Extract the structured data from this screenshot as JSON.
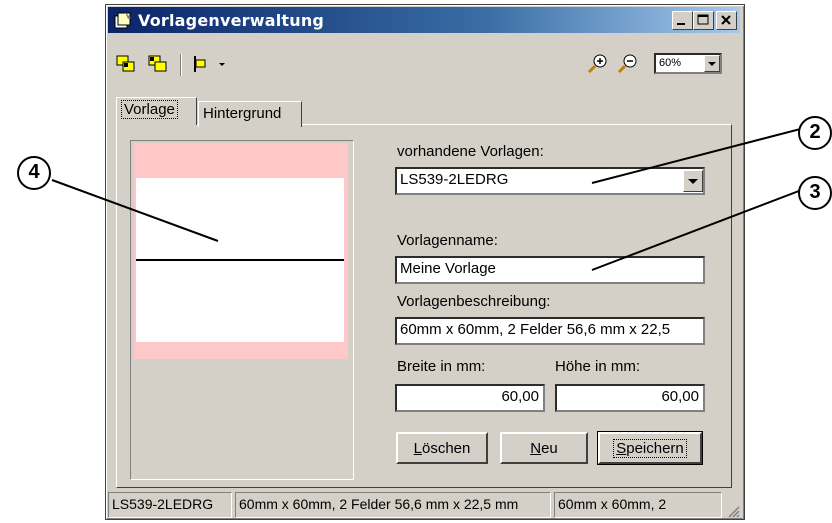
{
  "window": {
    "title": "Vorlagenverwaltung"
  },
  "toolbar": {
    "zoom_value": "60%"
  },
  "tabs": [
    {
      "label": "Vorlage"
    },
    {
      "label": "Hintergrund"
    }
  ],
  "form": {
    "templates_label": "vorhandene Vorlagen:",
    "templates_value": "LS539-2LEDRG",
    "name_label": "Vorlagenname:",
    "name_value": "Meine Vorlage",
    "desc_label": "Vorlagenbeschreibung:",
    "desc_value": "60mm x 60mm, 2 Felder 56,6 mm x 22,5",
    "width_label": "Breite in mm:",
    "width_value": "60,00",
    "height_label": "Höhe in mm:",
    "height_value": "60,00"
  },
  "buttons": {
    "delete": {
      "before": "",
      "mnemonic": "L",
      "after": "öschen"
    },
    "new": {
      "before": "",
      "mnemonic": "N",
      "after": "eu"
    },
    "save": {
      "before": "",
      "mnemonic": "S",
      "after": "peichern"
    }
  },
  "statusbar": {
    "cell1": "LS539-2LEDRG",
    "cell2": "60mm x 60mm, 2 Felder 56,6 mm x 22,5 mm",
    "cell3": "60mm x 60mm, 2"
  },
  "callouts": [
    "2",
    "3",
    "4"
  ],
  "colors": {
    "preview_margin": "#ffc8c8",
    "titlebar": "#0a246a"
  }
}
